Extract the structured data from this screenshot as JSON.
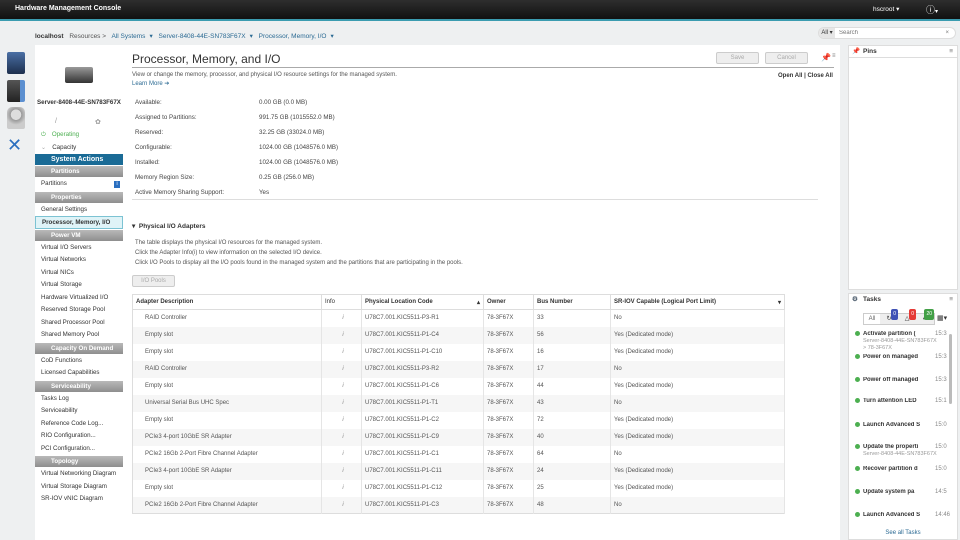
{
  "header": {
    "app_title": "Hardware Management Console",
    "user": "hscroot",
    "help_icon": "help-icon"
  },
  "breadcrumb": {
    "host": "localhost",
    "resources": "Resources >",
    "all_systems": "All Systems",
    "server": "Server-8408-44E-SN783F67X",
    "page": "Processor, Memory, I/O"
  },
  "search": {
    "scope": "All",
    "placeholder": "Search"
  },
  "sidebar": {
    "server_name": "Server-8408-44E-SN783F67X",
    "items": [
      {
        "type": "status",
        "label": "Operating"
      },
      {
        "type": "item",
        "label": "Capacity"
      },
      {
        "type": "action",
        "label": "System Actions"
      },
      {
        "type": "header",
        "label": "Partitions"
      },
      {
        "type": "item",
        "label": "Partitions",
        "badge": "i"
      },
      {
        "type": "header",
        "label": "Properties"
      },
      {
        "type": "item",
        "label": "General Settings"
      },
      {
        "type": "selected",
        "label": "Processor, Memory, I/O"
      },
      {
        "type": "header",
        "label": "Power VM"
      },
      {
        "type": "item",
        "label": "Virtual I/O Servers"
      },
      {
        "type": "item",
        "label": "Virtual Networks"
      },
      {
        "type": "item",
        "label": "Virtual NICs"
      },
      {
        "type": "item",
        "label": "Virtual Storage"
      },
      {
        "type": "item",
        "label": "Hardware Virtualized I/O"
      },
      {
        "type": "item",
        "label": "Reserved Storage Pool"
      },
      {
        "type": "item",
        "label": "Shared Processor Pool"
      },
      {
        "type": "item",
        "label": "Shared Memory Pool"
      },
      {
        "type": "header",
        "label": "Capacity On Demand"
      },
      {
        "type": "item",
        "label": "CoD Functions"
      },
      {
        "type": "item",
        "label": "Licensed Capabilities"
      },
      {
        "type": "header",
        "label": "Serviceability"
      },
      {
        "type": "item",
        "label": "Tasks Log"
      },
      {
        "type": "item",
        "label": "Serviceability"
      },
      {
        "type": "item",
        "label": "Reference Code Log..."
      },
      {
        "type": "item",
        "label": "RIO Configuration..."
      },
      {
        "type": "item",
        "label": "PCI Configuration..."
      },
      {
        "type": "header",
        "label": "Topology"
      },
      {
        "type": "item",
        "label": "Virtual Networking Diagram"
      },
      {
        "type": "item",
        "label": "Virtual Storage Diagram"
      },
      {
        "type": "item",
        "label": "SR-IOV vNIC Diagram"
      }
    ]
  },
  "main": {
    "title": "Processor, Memory, and I/O",
    "description": "View or change the memory, processor, and physical I/O resource settings for the managed system.",
    "learn_more": "Learn More",
    "save": "Save",
    "cancel": "Cancel",
    "open_all": "Open All",
    "close_all": "Close All",
    "memory": [
      {
        "label": "Available:",
        "value": "0.00 GB (0.0 MB)"
      },
      {
        "label": "Assigned to Partitions:",
        "value": "991.75 GB (1015552.0 MB)"
      },
      {
        "label": "Reserved:",
        "value": "32.25 GB (33024.0 MB)"
      },
      {
        "label": "Configurable:",
        "value": "1024.00 GB (1048576.0 MB)"
      },
      {
        "label": "Installed:",
        "value": "1024.00 GB (1048576.0 MB)"
      },
      {
        "label": "Memory Region Size:",
        "value": "0.25 GB (256.0 MB)"
      },
      {
        "label": "Active Memory Sharing Support:",
        "value": "Yes"
      }
    ],
    "io_section": {
      "title": "Physical I/O Adapters",
      "lines": [
        "The table displays the physical I/O resources for the managed system.",
        "Click the Adapter Info(i) to view information on the selected I/O device.",
        "Click I/O Pools to display all the I/O pools found in the managed system and the partitions that are participating in the pools."
      ],
      "io_pools": "I/O Pools",
      "columns": [
        "Adapter Description",
        "Info",
        "Physical Location Code",
        "Owner",
        "Bus Number",
        "SR-IOV Capable (Logical Port Limit)"
      ],
      "rows": [
        [
          "RAID Controller",
          "i",
          "U78C7.001.KIC5511-P3-R1",
          "78-3F67X",
          "33",
          "No"
        ],
        [
          "Empty slot",
          "i",
          "U78C7.001.KIC5511-P1-C4",
          "78-3F67X",
          "56",
          "Yes (Dedicated mode)"
        ],
        [
          "Empty slot",
          "i",
          "U78C7.001.KIC5511-P1-C10",
          "78-3F67X",
          "16",
          "Yes (Dedicated mode)"
        ],
        [
          "RAID Controller",
          "i",
          "U78C7.001.KIC5511-P3-R2",
          "78-3F67X",
          "17",
          "No"
        ],
        [
          "Empty slot",
          "i",
          "U78C7.001.KIC5511-P1-C6",
          "78-3F67X",
          "44",
          "Yes (Dedicated mode)"
        ],
        [
          "Universal Serial Bus UHC Spec",
          "i",
          "U78C7.001.KIC5511-P1-T1",
          "78-3F67X",
          "43",
          "No"
        ],
        [
          "Empty slot",
          "i",
          "U78C7.001.KIC5511-P1-C2",
          "78-3F67X",
          "72",
          "Yes (Dedicated mode)"
        ],
        [
          "PCIe3 4-port 10GbE SR Adapter",
          "i",
          "U78C7.001.KIC5511-P1-C9",
          "78-3F67X",
          "40",
          "Yes (Dedicated mode)"
        ],
        [
          "PCIe2 16Gb 2-Port Fibre Channel Adapter",
          "i",
          "U78C7.001.KIC5511-P1-C1",
          "78-3F67X",
          "64",
          "No"
        ],
        [
          "PCIe3 4-port 10GbE SR Adapter",
          "i",
          "U78C7.001.KIC5511-P1-C11",
          "78-3F67X",
          "24",
          "Yes (Dedicated mode)"
        ],
        [
          "Empty slot",
          "i",
          "U78C7.001.KIC5511-P1-C12",
          "78-3F67X",
          "25",
          "Yes (Dedicated mode)"
        ],
        [
          "PCIe2 16Gb 2-Port Fibre Channel Adapter",
          "i",
          "U78C7.001.KIC5511-P1-C3",
          "78-3F67X",
          "48",
          "No"
        ]
      ]
    }
  },
  "pins": {
    "title": "Pins"
  },
  "tasks": {
    "title": "Tasks",
    "filter_all": "All",
    "running_count": "0",
    "warning_count": "0",
    "done_count": "20",
    "items": [
      {
        "name": "Activate partition (",
        "time": "15:3",
        "sub": "Server-8408-44E-SN783F67X > 78-3F67X"
      },
      {
        "name": "Power on managed",
        "time": "15:3"
      },
      {
        "name": "Power off managed",
        "time": "15:3"
      },
      {
        "name": "Turn attention LED",
        "time": "15:1"
      },
      {
        "name": "Launch Advanced S",
        "time": "15:0"
      },
      {
        "name": "Update the properti",
        "time": "15:0",
        "sub": "Server-8408-44E-SN783F67X"
      },
      {
        "name": "Recover partition d",
        "time": "15:0"
      },
      {
        "name": "Update system pa",
        "time": "14:5"
      },
      {
        "name": "Launch Advanced S",
        "time": "14:46"
      }
    ],
    "see_all": "See all Tasks"
  },
  "colors": {
    "accent": "#3b9cb0",
    "selected_action": "#1a6b96",
    "link": "#2b6a93",
    "success": "#4caf50"
  }
}
